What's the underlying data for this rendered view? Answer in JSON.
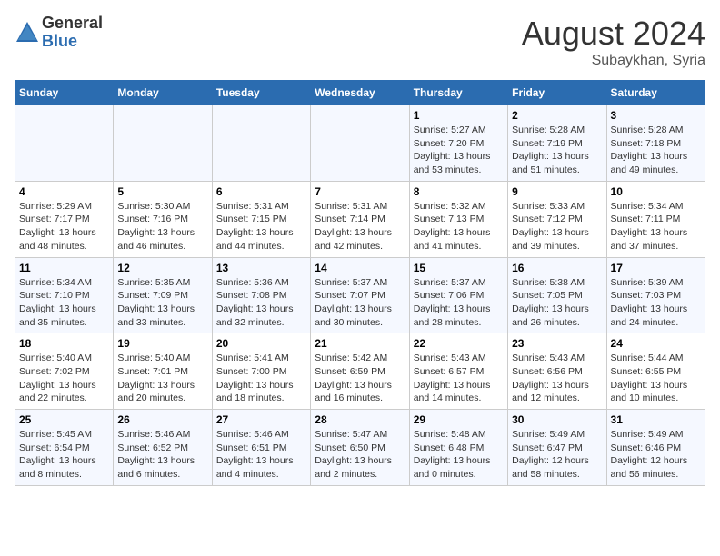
{
  "header": {
    "logo_line1": "General",
    "logo_line2": "Blue",
    "month_title": "August 2024",
    "subtitle": "Subaykhan, Syria"
  },
  "days_of_week": [
    "Sunday",
    "Monday",
    "Tuesday",
    "Wednesday",
    "Thursday",
    "Friday",
    "Saturday"
  ],
  "weeks": [
    [
      {
        "num": "",
        "info": ""
      },
      {
        "num": "",
        "info": ""
      },
      {
        "num": "",
        "info": ""
      },
      {
        "num": "",
        "info": ""
      },
      {
        "num": "1",
        "info": "Sunrise: 5:27 AM\nSunset: 7:20 PM\nDaylight: 13 hours and 53 minutes."
      },
      {
        "num": "2",
        "info": "Sunrise: 5:28 AM\nSunset: 7:19 PM\nDaylight: 13 hours and 51 minutes."
      },
      {
        "num": "3",
        "info": "Sunrise: 5:28 AM\nSunset: 7:18 PM\nDaylight: 13 hours and 49 minutes."
      }
    ],
    [
      {
        "num": "4",
        "info": "Sunrise: 5:29 AM\nSunset: 7:17 PM\nDaylight: 13 hours and 48 minutes."
      },
      {
        "num": "5",
        "info": "Sunrise: 5:30 AM\nSunset: 7:16 PM\nDaylight: 13 hours and 46 minutes."
      },
      {
        "num": "6",
        "info": "Sunrise: 5:31 AM\nSunset: 7:15 PM\nDaylight: 13 hours and 44 minutes."
      },
      {
        "num": "7",
        "info": "Sunrise: 5:31 AM\nSunset: 7:14 PM\nDaylight: 13 hours and 42 minutes."
      },
      {
        "num": "8",
        "info": "Sunrise: 5:32 AM\nSunset: 7:13 PM\nDaylight: 13 hours and 41 minutes."
      },
      {
        "num": "9",
        "info": "Sunrise: 5:33 AM\nSunset: 7:12 PM\nDaylight: 13 hours and 39 minutes."
      },
      {
        "num": "10",
        "info": "Sunrise: 5:34 AM\nSunset: 7:11 PM\nDaylight: 13 hours and 37 minutes."
      }
    ],
    [
      {
        "num": "11",
        "info": "Sunrise: 5:34 AM\nSunset: 7:10 PM\nDaylight: 13 hours and 35 minutes."
      },
      {
        "num": "12",
        "info": "Sunrise: 5:35 AM\nSunset: 7:09 PM\nDaylight: 13 hours and 33 minutes."
      },
      {
        "num": "13",
        "info": "Sunrise: 5:36 AM\nSunset: 7:08 PM\nDaylight: 13 hours and 32 minutes."
      },
      {
        "num": "14",
        "info": "Sunrise: 5:37 AM\nSunset: 7:07 PM\nDaylight: 13 hours and 30 minutes."
      },
      {
        "num": "15",
        "info": "Sunrise: 5:37 AM\nSunset: 7:06 PM\nDaylight: 13 hours and 28 minutes."
      },
      {
        "num": "16",
        "info": "Sunrise: 5:38 AM\nSunset: 7:05 PM\nDaylight: 13 hours and 26 minutes."
      },
      {
        "num": "17",
        "info": "Sunrise: 5:39 AM\nSunset: 7:03 PM\nDaylight: 13 hours and 24 minutes."
      }
    ],
    [
      {
        "num": "18",
        "info": "Sunrise: 5:40 AM\nSunset: 7:02 PM\nDaylight: 13 hours and 22 minutes."
      },
      {
        "num": "19",
        "info": "Sunrise: 5:40 AM\nSunset: 7:01 PM\nDaylight: 13 hours and 20 minutes."
      },
      {
        "num": "20",
        "info": "Sunrise: 5:41 AM\nSunset: 7:00 PM\nDaylight: 13 hours and 18 minutes."
      },
      {
        "num": "21",
        "info": "Sunrise: 5:42 AM\nSunset: 6:59 PM\nDaylight: 13 hours and 16 minutes."
      },
      {
        "num": "22",
        "info": "Sunrise: 5:43 AM\nSunset: 6:57 PM\nDaylight: 13 hours and 14 minutes."
      },
      {
        "num": "23",
        "info": "Sunrise: 5:43 AM\nSunset: 6:56 PM\nDaylight: 13 hours and 12 minutes."
      },
      {
        "num": "24",
        "info": "Sunrise: 5:44 AM\nSunset: 6:55 PM\nDaylight: 13 hours and 10 minutes."
      }
    ],
    [
      {
        "num": "25",
        "info": "Sunrise: 5:45 AM\nSunset: 6:54 PM\nDaylight: 13 hours and 8 minutes."
      },
      {
        "num": "26",
        "info": "Sunrise: 5:46 AM\nSunset: 6:52 PM\nDaylight: 13 hours and 6 minutes."
      },
      {
        "num": "27",
        "info": "Sunrise: 5:46 AM\nSunset: 6:51 PM\nDaylight: 13 hours and 4 minutes."
      },
      {
        "num": "28",
        "info": "Sunrise: 5:47 AM\nSunset: 6:50 PM\nDaylight: 13 hours and 2 minutes."
      },
      {
        "num": "29",
        "info": "Sunrise: 5:48 AM\nSunset: 6:48 PM\nDaylight: 13 hours and 0 minutes."
      },
      {
        "num": "30",
        "info": "Sunrise: 5:49 AM\nSunset: 6:47 PM\nDaylight: 12 hours and 58 minutes."
      },
      {
        "num": "31",
        "info": "Sunrise: 5:49 AM\nSunset: 6:46 PM\nDaylight: 12 hours and 56 minutes."
      }
    ]
  ]
}
